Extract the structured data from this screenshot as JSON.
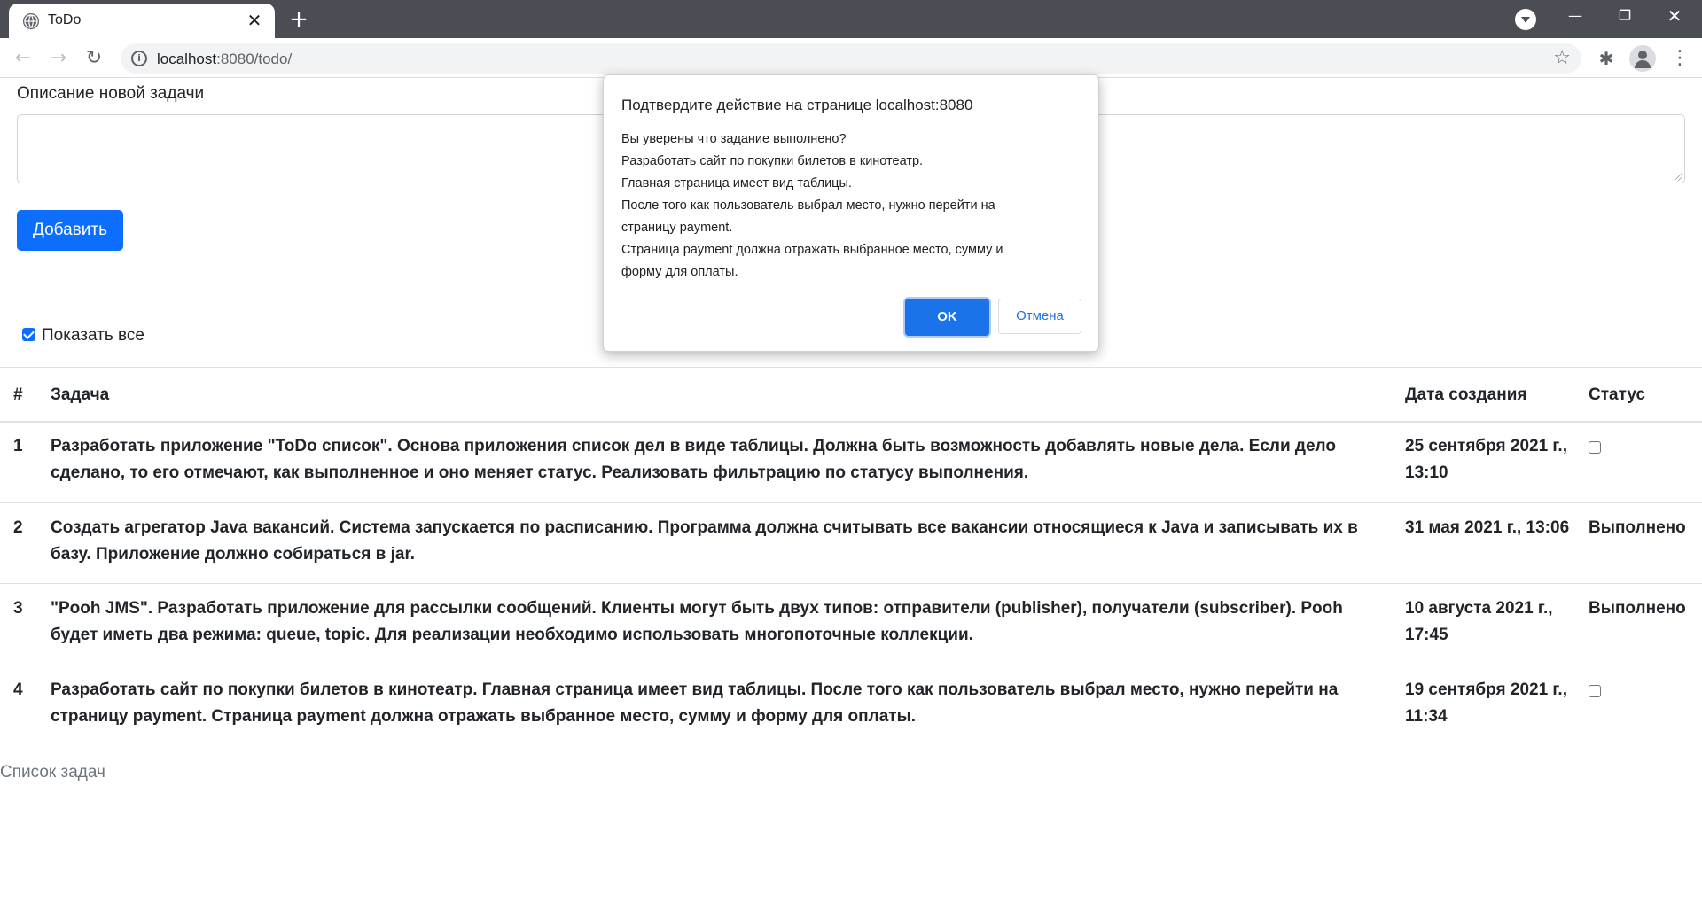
{
  "browser": {
    "tab_title": "ToDo",
    "tab_close": "✕",
    "new_tab": "+",
    "url_host": "localhost",
    "url_path": ":8080/todo/",
    "win_min": "—",
    "win_max": "❐",
    "win_close": "✕"
  },
  "form": {
    "description_label": "Описание новой задачи",
    "description_value": "",
    "add_button": "Добавить",
    "show_all_label": "Показать все",
    "show_all_checked": true
  },
  "table": {
    "headers": {
      "num": "#",
      "task": "Задача",
      "created": "Дата создания",
      "status": "Статус"
    },
    "rows": [
      {
        "num": "1",
        "task": "Разработать приложение \"ToDo список\". Основа приложения список дел в виде таблицы. Должна быть возможность добавлять новые дела. Если дело сделано, то его отмечают, как выполненное и оно меняет статус. Реализовать фильтрацию по статусу выполнения.",
        "created": "25 сентября 2021 г., 13:10",
        "status": ""
      },
      {
        "num": "2",
        "task": "Создать агрегатор Java вакансий. Система запускается по расписанию. Программа должна считывать все вакансии относящиеся к Java и записывать их в базу. Приложение должно собираться в jar.",
        "created": "31 мая 2021 г., 13:06",
        "status": "Выполнено"
      },
      {
        "num": "3",
        "task": "\"Pooh JMS\". Разработать приложение для рассылки сообщений. Клиенты могут быть двух типов: отправители (publisher), получатели (subscriber). Pooh будет иметь два режима: queue, topic. Для реализации необходимо использовать многопоточные коллекции.",
        "created": "10 августа 2021 г., 17:45",
        "status": "Выполнено"
      },
      {
        "num": "4",
        "task": "Разработать сайт по покупки билетов в кинотеатр. Главная страница имеет вид таблицы. После того как пользователь выбрал место, нужно перейти на страницу payment. Страница payment должна отражать выбранное место, сумму и форму для оплаты.",
        "created": "19 сентября 2021 г., 11:34",
        "status": ""
      }
    ]
  },
  "footer": "Список задач",
  "dialog": {
    "title": "Подтвердите действие на странице localhost:8080",
    "lines": [
      "Вы уверены что задание выполнено?",
      "Разработать сайт по покупки билетов в кинотеатр.",
      "Главная страница имеет вид таблицы.",
      "После того как пользователь выбрал место, нужно перейти на",
      "страницу payment.",
      "Страница payment должна отражать выбранное место, сумму и",
      "форму для оплаты."
    ],
    "ok": "OK",
    "cancel": "Отмена"
  },
  "colors": {
    "primary": "#0d6efd",
    "dialog_ok": "#1a73e8",
    "chrome": "#4a4e54"
  }
}
